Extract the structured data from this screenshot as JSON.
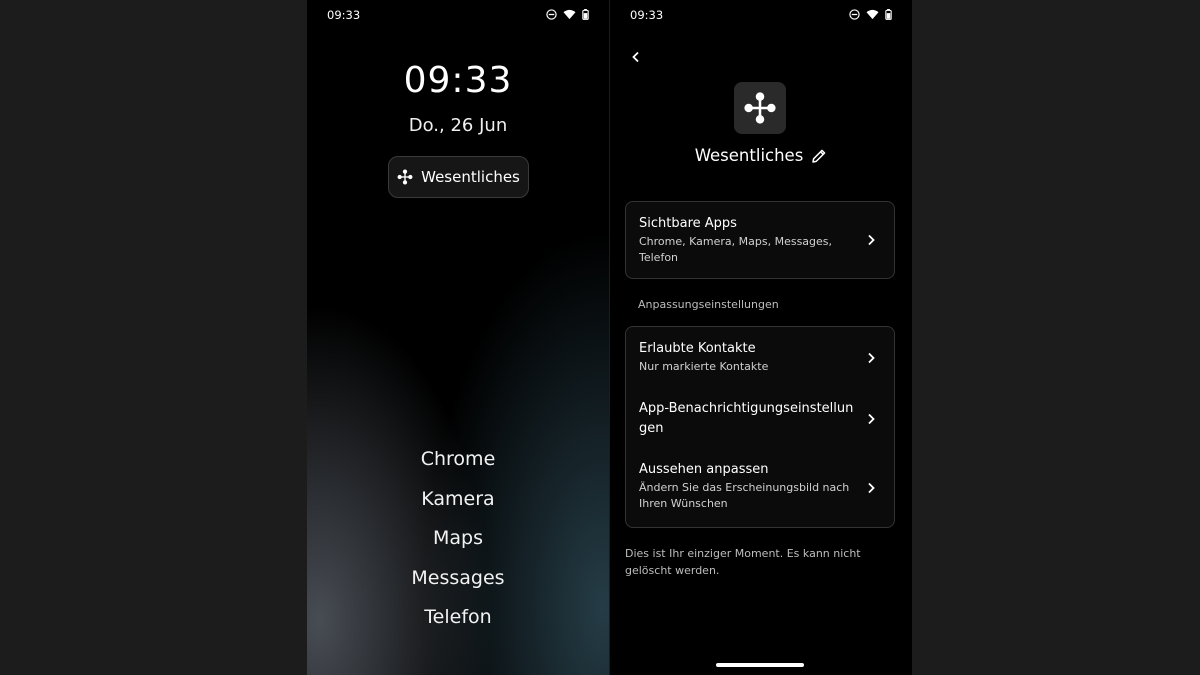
{
  "left_screen": {
    "status_bar": {
      "time": "09:33",
      "icons": [
        "do-not-disturb-icon",
        "wifi-icon",
        "battery-icon"
      ]
    },
    "clock": "09:33",
    "date": "Do., 26 Jun",
    "mode_chip": {
      "icon": "mode-flower-icon",
      "label": "Wesentliches"
    },
    "apps": [
      {
        "label": "Chrome"
      },
      {
        "label": "Kamera"
      },
      {
        "label": "Maps"
      },
      {
        "label": "Messages"
      },
      {
        "label": "Telefon"
      }
    ]
  },
  "right_screen": {
    "status_bar": {
      "time": "09:33",
      "icons": [
        "do-not-disturb-icon",
        "wifi-icon",
        "battery-icon"
      ]
    },
    "back_icon": "back-arrow-icon",
    "mode_icon": "mode-flower-icon",
    "mode_title": "Wesentliches",
    "edit_icon": "pencil-icon",
    "visible_apps": {
      "title": "Sichtbare Apps",
      "subtitle": "Chrome, Kamera, Maps, Messages, Telefon"
    },
    "section_label": "Anpassungseinstellungen",
    "settings": [
      {
        "title": "Erlaubte Kontakte",
        "subtitle": "Nur markierte Kontakte"
      },
      {
        "title": "App-Benachrichtigungseinstellungen",
        "subtitle": ""
      },
      {
        "title": "Aussehen anpassen",
        "subtitle": "Ändern Sie das Erscheinungsbild nach Ihren Wünschen"
      }
    ],
    "footer_note": "Dies ist Ihr einziger Moment. Es kann nicht gelöscht werden."
  },
  "colors": {
    "background": "#1c1c1c",
    "screen": "#000000",
    "card_border": "#333333",
    "text": "#ffffff",
    "secondary_text": "#bdbdbd"
  }
}
